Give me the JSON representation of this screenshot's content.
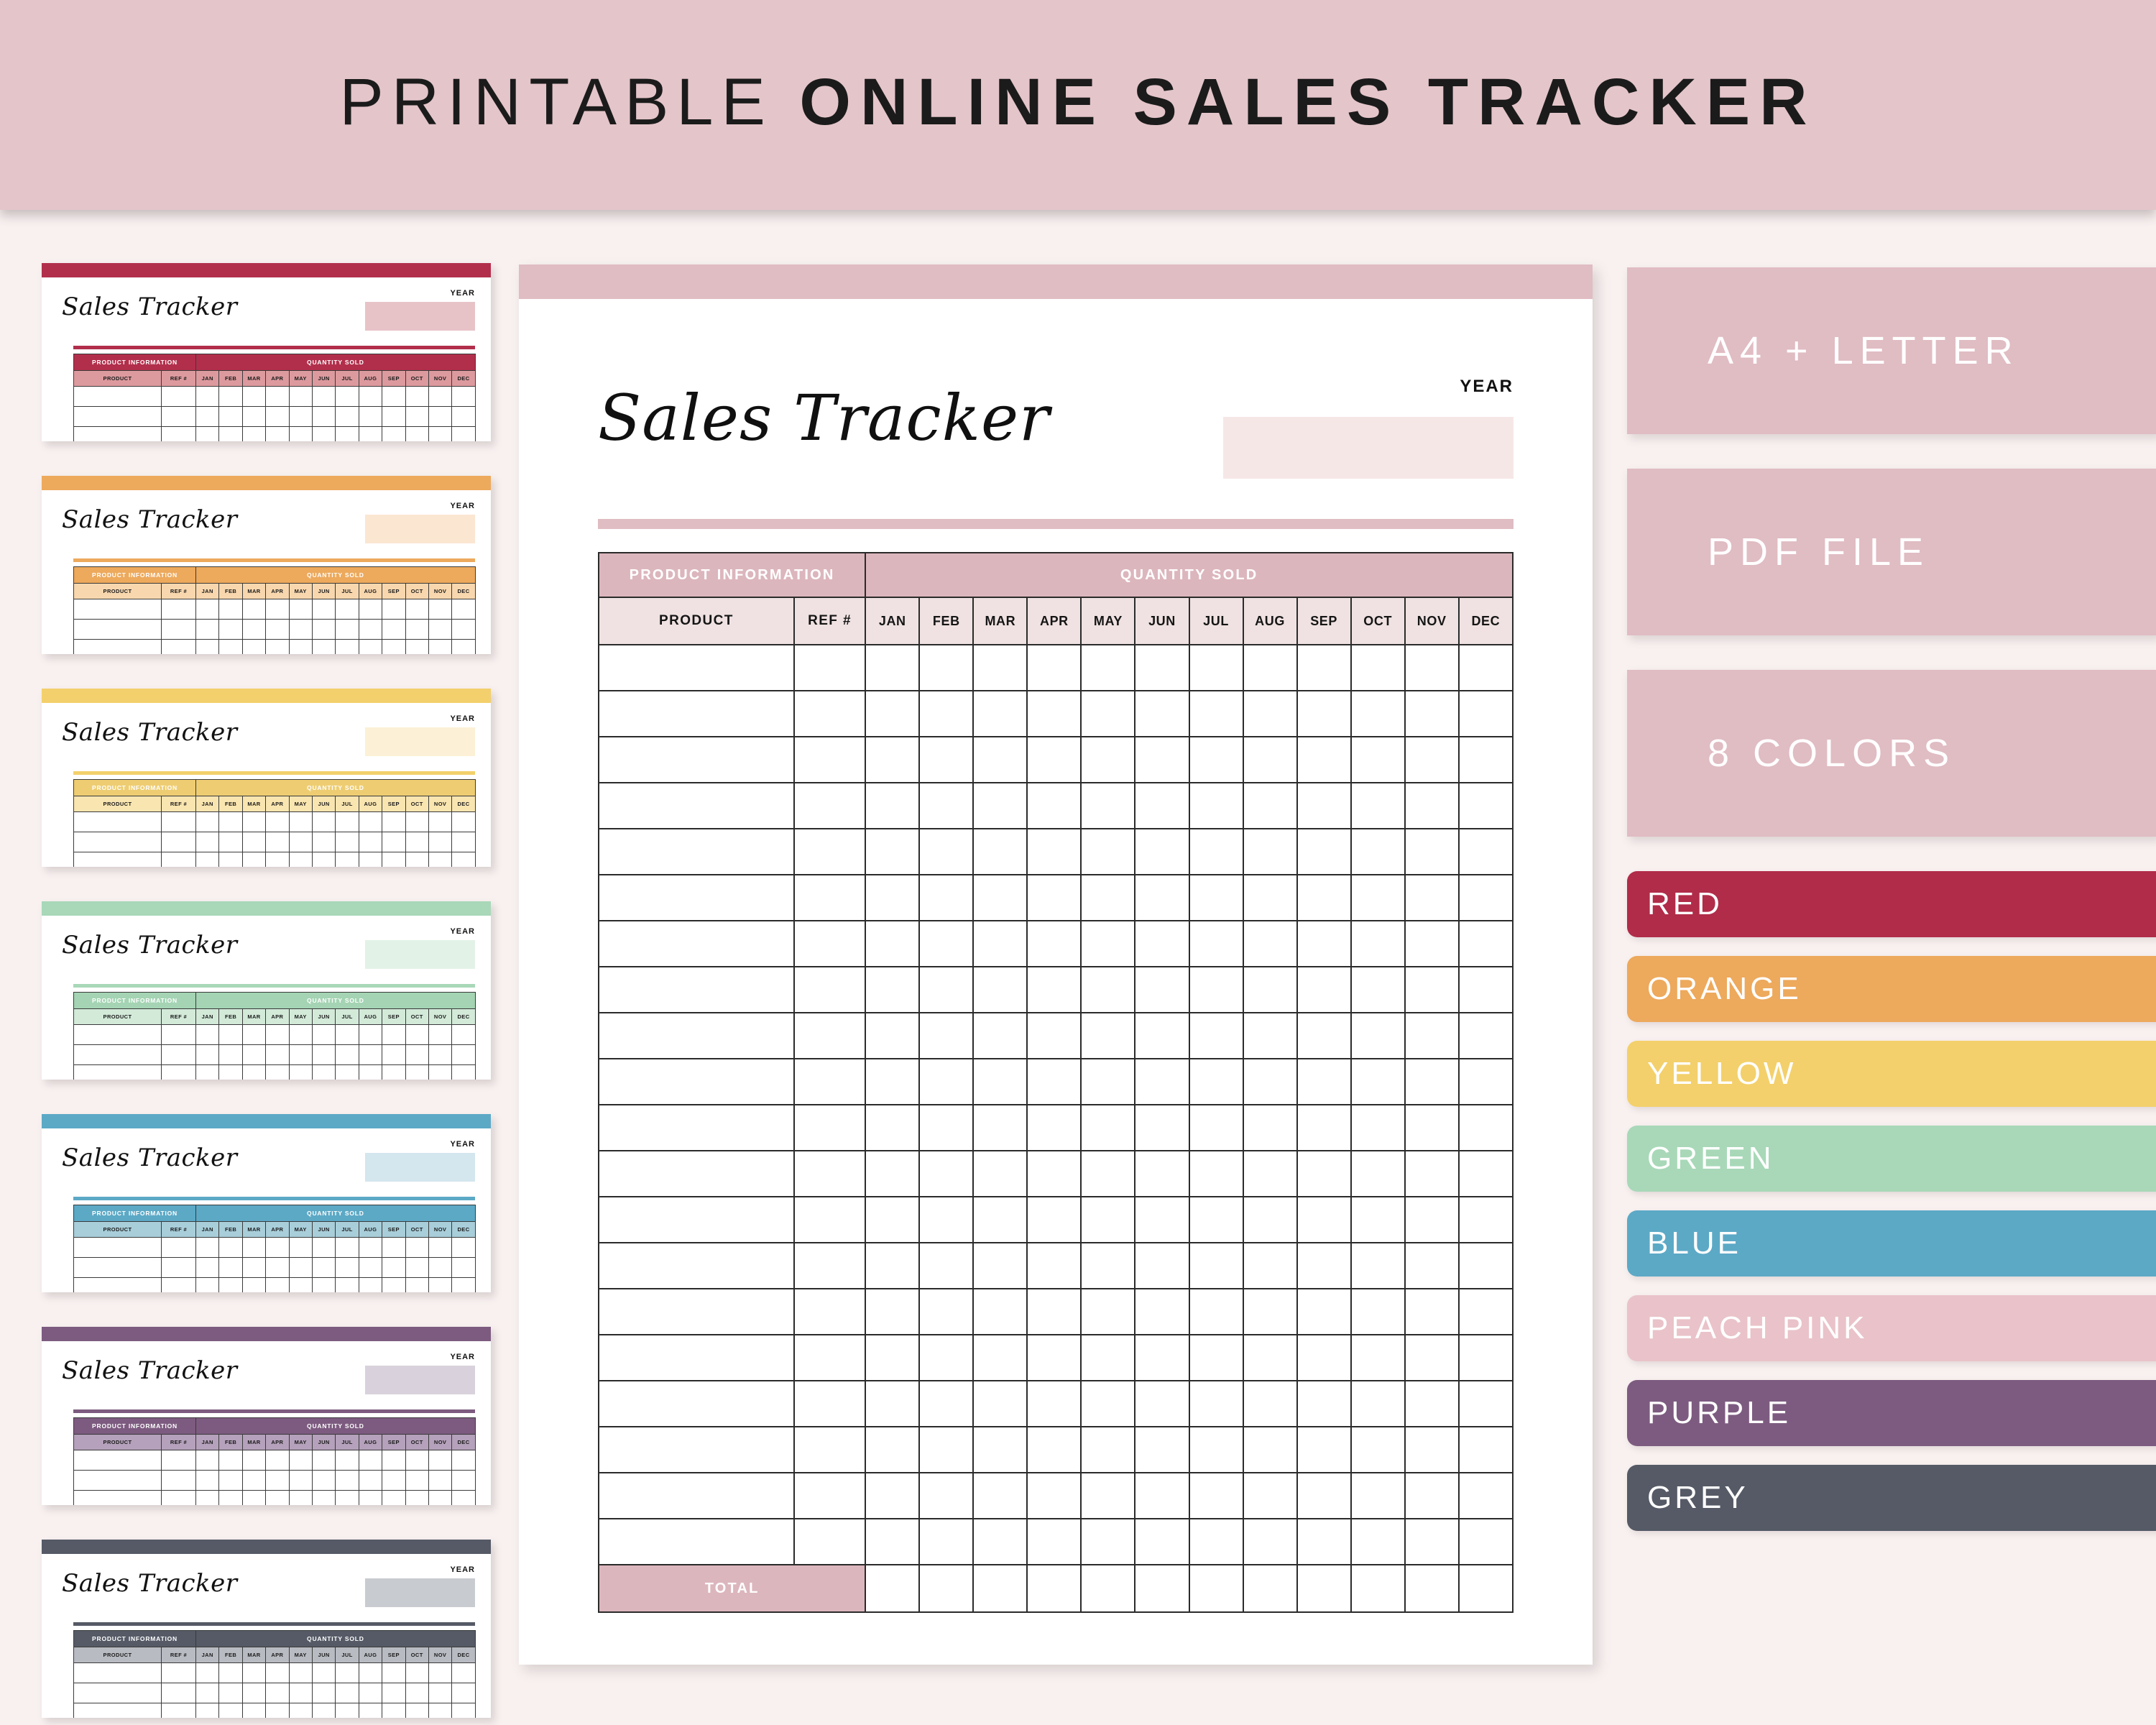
{
  "banner": {
    "title_light": "PRINTABLE",
    "title_bold": "ONLINE SALES TRACKER"
  },
  "document": {
    "script_title": "Sales Tracker",
    "year_label": "YEAR",
    "year_value": "",
    "table": {
      "group_headers": [
        "PRODUCT INFORMATION",
        "QUANTITY SOLD"
      ],
      "column_headers": [
        "PRODUCT",
        "REF #",
        "JAN",
        "FEB",
        "MAR",
        "APR",
        "MAY",
        "JUN",
        "JUL",
        "AUG",
        "SEP",
        "OCT",
        "NOV",
        "DEC"
      ],
      "months": [
        "JAN",
        "FEB",
        "MAR",
        "APR",
        "MAY",
        "JUN",
        "JUL",
        "AUG",
        "SEP",
        "OCT",
        "NOV",
        "DEC"
      ],
      "product_header": "PRODUCT",
      "ref_header": "REF #",
      "data_row_count": 20,
      "total_label": "TOTAL",
      "rows": []
    },
    "colors": {
      "accent": "#e0bcc3",
      "header_fill": "#dcb6bd",
      "subheader_fill": "#f0e2e2",
      "year_box_fill": "#f6e7e7",
      "grid_line": "#2b2b2b"
    }
  },
  "thumbnails": [
    {
      "name": "red",
      "script_title": "Sales Tracker",
      "year_label": "YEAR",
      "bar": "#b22f4b",
      "header": "#b22f4b",
      "sub": "#dd9a9e",
      "yearbox": "#e7c3c7",
      "divider": "#b22f4b"
    },
    {
      "name": "orange",
      "script_title": "Sales Tracker",
      "year_label": "YEAR",
      "bar": "#eda95c",
      "header": "#eda95c",
      "sub": "#f8d7ae",
      "yearbox": "#fbe6d2",
      "divider": "#eda95c"
    },
    {
      "name": "yellow",
      "script_title": "Sales Tracker",
      "year_label": "YEAR",
      "bar": "#f3d06b",
      "header": "#eecd72",
      "sub": "#f9e5b0",
      "yearbox": "#fcf0d6",
      "divider": "#f3d06b"
    },
    {
      "name": "green",
      "script_title": "Sales Tracker",
      "year_label": "YEAR",
      "bar": "#a8d8b8",
      "header": "#a4d4b3",
      "sub": "#d3ead9",
      "yearbox": "#e3f2e7",
      "divider": "#a8d8b8"
    },
    {
      "name": "blue",
      "script_title": "Sales Tracker",
      "year_label": "YEAR",
      "bar": "#5ca9c6",
      "header": "#5ca9c6",
      "sub": "#a8ceda",
      "yearbox": "#d4e6ee",
      "divider": "#5ca9c6"
    },
    {
      "name": "purple",
      "script_title": "Sales Tracker",
      "year_label": "YEAR",
      "bar": "#7d5b80",
      "header": "#7d5b80",
      "sub": "#b5a1bb",
      "yearbox": "#d9d1dc",
      "divider": "#7d5b80"
    },
    {
      "name": "grey",
      "script_title": "Sales Tracker",
      "year_label": "YEAR",
      "bar": "#555a66",
      "header": "#555a66",
      "sub": "#b8bbc2",
      "yearbox": "#c8cbd0",
      "divider": "#555a66"
    }
  ],
  "sidebar": {
    "features": [
      {
        "label": "A4 + LETTER"
      },
      {
        "label": "PDF FILE"
      },
      {
        "label": "8 COLORS"
      }
    ],
    "colors": [
      {
        "label": "RED",
        "hex": "#b02c49"
      },
      {
        "label": "ORANGE",
        "hex": "#eda95c"
      },
      {
        "label": "YELLOW",
        "hex": "#f3d06b"
      },
      {
        "label": "GREEN",
        "hex": "#a8d8b8"
      },
      {
        "label": "BLUE",
        "hex": "#5ca9c6"
      },
      {
        "label": "PEACH PINK",
        "hex": "#e9c3c9"
      },
      {
        "label": "PURPLE",
        "hex": "#7d5b80"
      },
      {
        "label": "GREY",
        "hex": "#555a66"
      }
    ]
  }
}
